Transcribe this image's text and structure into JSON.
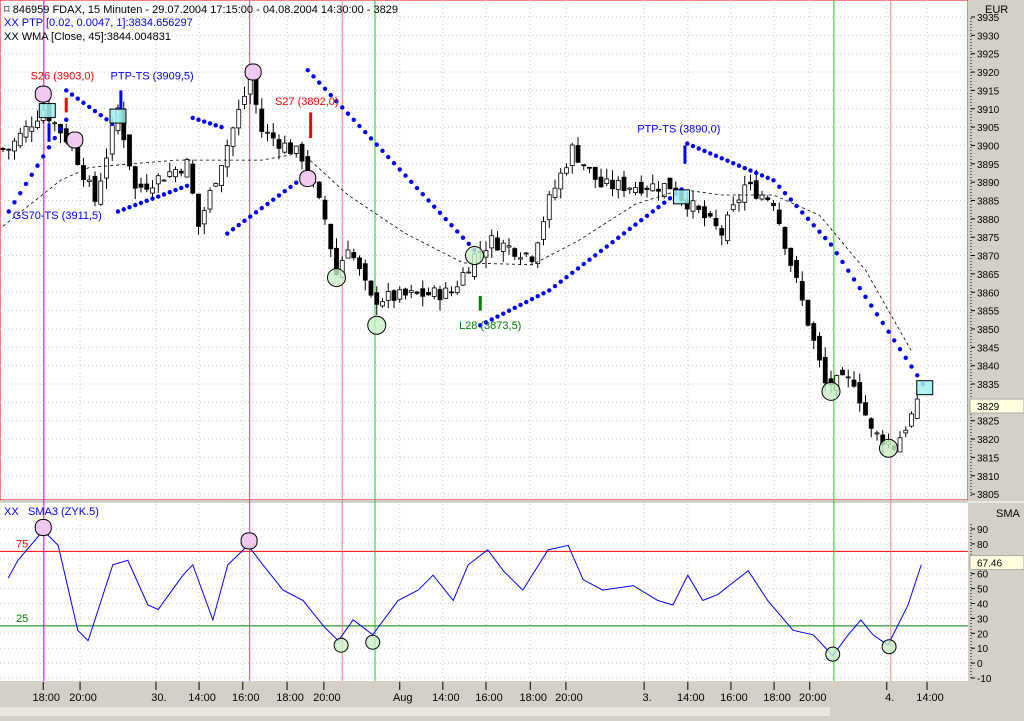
{
  "header": {
    "title": "846959  FDAX, 15 Minuten - 29.07.2004 17:15:00 - 04.08.2004 14:30:00 - 3829",
    "ptp": "XX PTP [0.02, 0.0047, 1]:3834.656297",
    "wma": "XX WMA [Close, 45]:3844.004831"
  },
  "colors": {
    "ptp": "#0000ff",
    "wma": "#000000",
    "up": "#ffffff",
    "down": "#000000",
    "sell": "#ff0000",
    "buy": "#008000",
    "pink": "#f0c8f0",
    "green": "#c8f0c8",
    "cyan": "#a0f0f0"
  },
  "chart_data": [
    {
      "type": "candlestick",
      "title": "FDAX 15 Minuten",
      "currency": "EUR",
      "ylim": [
        3805,
        3935
      ],
      "y_ticks": [
        3805,
        3810,
        3815,
        3820,
        3825,
        3830,
        3835,
        3840,
        3845,
        3850,
        3855,
        3860,
        3865,
        3870,
        3875,
        3880,
        3885,
        3890,
        3895,
        3900,
        3905,
        3910,
        3915,
        3920,
        3925,
        3930,
        3935
      ],
      "last_price": "3829",
      "close_anchors": [
        [
          1,
          3899
        ],
        [
          7,
          3910
        ],
        [
          12,
          3900
        ],
        [
          16,
          3885
        ],
        [
          20,
          3910
        ],
        [
          23,
          3888
        ],
        [
          32,
          3895
        ],
        [
          34,
          3878
        ],
        [
          43,
          3918
        ],
        [
          45,
          3904
        ],
        [
          52,
          3897
        ],
        [
          56,
          3880
        ],
        [
          58,
          3865
        ],
        [
          60,
          3873
        ],
        [
          64,
          3858
        ],
        [
          70,
          3859
        ],
        [
          78,
          3860
        ],
        [
          82,
          3870
        ],
        [
          85,
          3874
        ],
        [
          92,
          3870
        ],
        [
          95,
          3885
        ],
        [
          99,
          3899
        ],
        [
          104,
          3889
        ],
        [
          117,
          3889
        ],
        [
          118,
          3886
        ],
        [
          125,
          3876
        ],
        [
          129,
          3889
        ],
        [
          134,
          3885
        ],
        [
          137,
          3868
        ],
        [
          140,
          3852
        ],
        [
          143,
          3835
        ],
        [
          148,
          3836
        ],
        [
          151,
          3822
        ],
        [
          155,
          3818
        ],
        [
          159,
          3829
        ]
      ],
      "psar_segments": [
        [
          [
            1,
            3882
          ],
          [
            11,
            3907
          ]
        ],
        [
          [
            11,
            3915
          ],
          [
            19,
            3906
          ]
        ],
        [
          [
            20,
            3882
          ],
          [
            32,
            3889
          ]
        ],
        [
          [
            33,
            3907.5
          ],
          [
            38,
            3905
          ]
        ],
        [
          [
            39,
            3876
          ],
          [
            52,
            3891
          ]
        ],
        [
          [
            53,
            3920.5
          ],
          [
            82,
            3871.5
          ]
        ],
        [
          [
            83,
            3851
          ],
          [
            95,
            3860.5
          ],
          [
            118,
            3888
          ]
        ],
        [
          [
            119,
            3900.5
          ],
          [
            134,
            3890.5
          ],
          [
            144,
            3873
          ],
          [
            160,
            3835
          ]
        ]
      ],
      "wma": [
        [
          0,
          3878
        ],
        [
          10,
          3890.5
        ],
        [
          15,
          3894
        ],
        [
          30,
          3896
        ],
        [
          45,
          3896
        ],
        [
          52,
          3898
        ],
        [
          60,
          3886.5
        ],
        [
          70,
          3876
        ],
        [
          80,
          3868
        ],
        [
          92,
          3867.5
        ],
        [
          100,
          3874
        ],
        [
          110,
          3884
        ],
        [
          118,
          3888
        ],
        [
          125,
          3886.5
        ],
        [
          134,
          3886.5
        ],
        [
          142,
          3881
        ],
        [
          150,
          3866
        ],
        [
          158,
          3844
        ]
      ],
      "pink_markers": [
        [
          7,
          3914
        ],
        [
          12.5,
          3901.5
        ],
        [
          43.5,
          3920
        ],
        [
          53,
          3891
        ]
      ],
      "green_markers": [
        [
          58,
          3864
        ],
        [
          65,
          3851
        ],
        [
          82,
          3870
        ],
        [
          144,
          3833
        ],
        [
          154,
          3817.5
        ]
      ],
      "cyan_markers": [
        [
          7.7,
          3909.5
        ],
        [
          20,
          3908
        ],
        [
          118,
          3886
        ],
        [
          160.3,
          3834
        ]
      ],
      "signals": [
        {
          "bar": 11,
          "from": 3913,
          "to": 3909,
          "kind": "sell"
        },
        {
          "bar": 8,
          "from": 3906,
          "to": 3901,
          "kind": "ptp"
        },
        {
          "bar": 20.5,
          "from": 3915,
          "to": 3910,
          "kind": "ptp"
        },
        {
          "bar": 53.5,
          "from": 3909,
          "to": 3902,
          "kind": "sell"
        },
        {
          "bar": 83,
          "from": 3859,
          "to": 3855,
          "kind": "buy"
        },
        {
          "bar": 118.6,
          "from": 3900,
          "to": 3895,
          "kind": "ptp"
        }
      ],
      "annotations": [
        {
          "text": "S26 (3903,0)",
          "bar": 4.8,
          "price": 3918,
          "kind": "sell"
        },
        {
          "text": "PTP-TS (3909,5)",
          "bar": 18.7,
          "price": 3918,
          "kind": "ptp"
        },
        {
          "text": "GS70-TS (3911,5)",
          "bar": 1.7,
          "price": 3880,
          "kind": "ptp"
        },
        {
          "text": "S27 (3892,0)",
          "bar": 47.3,
          "price": 3911,
          "kind": "sell"
        },
        {
          "text": "PTP-TS (3890,0)",
          "bar": 110.3,
          "price": 3903.5,
          "kind": "ptp"
        },
        {
          "text": "L28 (3873,5)",
          "bar": 79.3,
          "price": 3850,
          "kind": "buy"
        }
      ]
    },
    {
      "type": "line",
      "title": "SMA3 (ZYK.5)",
      "prefix": "XX",
      "axis_label": "SMA",
      "ylim": [
        -10,
        90
      ],
      "y_ticks": [
        -10,
        0,
        10,
        20,
        30,
        40,
        50,
        60,
        70,
        80,
        90
      ],
      "levels": [
        {
          "value": 75,
          "label": "75",
          "color": "#ff0000"
        },
        {
          "value": 25,
          "label": "25",
          "color": "#008000"
        }
      ],
      "last_value": "67.46",
      "values": [
        [
          0.9,
          57
        ],
        [
          2.6,
          69
        ],
        [
          7,
          89
        ],
        [
          9.6,
          79
        ],
        [
          13,
          22
        ],
        [
          14.8,
          15
        ],
        [
          19.1,
          66
        ],
        [
          21.7,
          69
        ],
        [
          25.2,
          39
        ],
        [
          27,
          36
        ],
        [
          31.3,
          59
        ],
        [
          33,
          66
        ],
        [
          36.5,
          29
        ],
        [
          39.1,
          66
        ],
        [
          42.6,
          79
        ],
        [
          45.2,
          66
        ],
        [
          48.7,
          49
        ],
        [
          52.2,
          42
        ],
        [
          55.7,
          25
        ],
        [
          58.3,
          15
        ],
        [
          60.9,
          29
        ],
        [
          64.3,
          19
        ],
        [
          68.7,
          42
        ],
        [
          72.2,
          49
        ],
        [
          74.8,
          59
        ],
        [
          78.3,
          42
        ],
        [
          80.9,
          66
        ],
        [
          84.3,
          76
        ],
        [
          87,
          62
        ],
        [
          90.4,
          49
        ],
        [
          94.8,
          76
        ],
        [
          98.3,
          79
        ],
        [
          100.9,
          56
        ],
        [
          104.3,
          49
        ],
        [
          109.6,
          52
        ],
        [
          113.9,
          42
        ],
        [
          116.5,
          39
        ],
        [
          119.1,
          59
        ],
        [
          121.7,
          42
        ],
        [
          124.3,
          46
        ],
        [
          129.6,
          62
        ],
        [
          133,
          42
        ],
        [
          137.4,
          22
        ],
        [
          140.9,
          19
        ],
        [
          144.3,
          5
        ],
        [
          147,
          19
        ],
        [
          149.2,
          29
        ],
        [
          151.3,
          19
        ],
        [
          153.9,
          12
        ],
        [
          157.4,
          39
        ],
        [
          159.7,
          66
        ]
      ],
      "pink_markers": [
        [
          7,
          91
        ],
        [
          42.8,
          82
        ]
      ],
      "green_markers": [
        [
          58.8,
          12
        ],
        [
          64.3,
          14
        ],
        [
          144.3,
          6
        ],
        [
          154.1,
          11
        ]
      ]
    }
  ],
  "x_axis": {
    "ticks": [
      {
        "label": "18:00",
        "bar": 7
      },
      {
        "label": "20:00",
        "bar": 13.4
      },
      {
        "label": "30.",
        "bar": 26.6
      },
      {
        "label": "14:00",
        "bar": 34.1
      },
      {
        "label": "16:00",
        "bar": 41.7
      },
      {
        "label": "18:00",
        "bar": 49.4
      },
      {
        "label": "20:00",
        "bar": 55.8
      },
      {
        "label": "Aug",
        "bar": 69
      },
      {
        "label": "14:00",
        "bar": 76.5
      },
      {
        "label": "16:00",
        "bar": 84
      },
      {
        "label": "18:00",
        "bar": 91.7
      },
      {
        "label": "20:00",
        "bar": 97.9
      },
      {
        "label": "3.",
        "bar": 111.5
      },
      {
        "label": "14:00",
        "bar": 119.1
      },
      {
        "label": "16:00",
        "bar": 126.6
      },
      {
        "label": "18:00",
        "bar": 134.1
      },
      {
        "label": "20:00",
        "bar": 140.3
      },
      {
        "label": "4.",
        "bar": 153.7
      },
      {
        "label": "14:00",
        "bar": 160.7
      }
    ]
  },
  "cycle_lines": [
    {
      "bar": 7.1,
      "color": "#e000e0"
    },
    {
      "bar": 42.9,
      "color": "#c040e0"
    },
    {
      "bar": 59,
      "color": "#f08080"
    },
    {
      "bar": 64.7,
      "color": "#00e000"
    },
    {
      "bar": 144.5,
      "color": "#00e000"
    },
    {
      "bar": 154.4,
      "color": "#f08080"
    }
  ]
}
